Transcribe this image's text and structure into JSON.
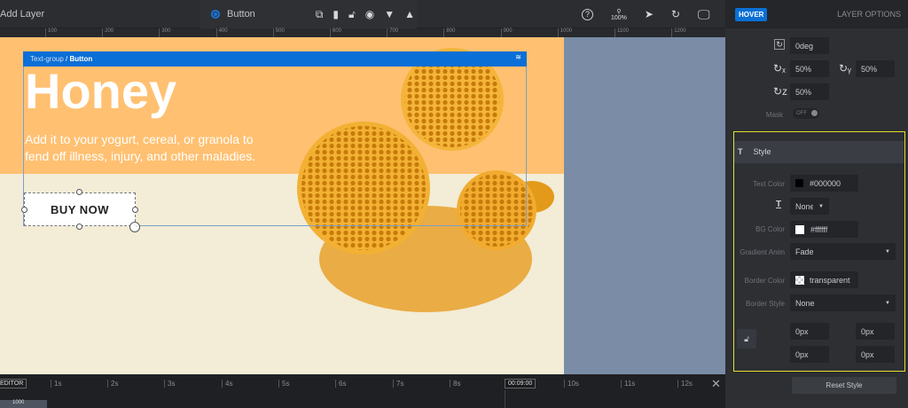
{
  "toolbar": {
    "add_layer": "Add Layer",
    "layer_name": "Button",
    "zoom": "100%"
  },
  "ruler": [
    "100",
    "200",
    "300",
    "400",
    "500",
    "600",
    "700",
    "800",
    "900",
    "1000",
    "1100",
    "1200"
  ],
  "canvas": {
    "breadcrumb_parent": "Text-group",
    "breadcrumb_sep": " / ",
    "breadcrumb_current": "Button",
    "heading": "Honey",
    "body_line1": "Add it to your yogurt, cereal, or granola to",
    "body_line2": "fend off illness, injury, and other maladies.",
    "button": "BUY NOW"
  },
  "panel": {
    "hover_tab": "HOVER",
    "layer_options_tab": "LAYER OPTIONS",
    "rotate": "0deg",
    "rot_x": "50%",
    "rot_y": "50%",
    "rot_z": "50%",
    "mask_label": "Mask",
    "mask_value": "OFF",
    "style_title": "Style",
    "text_color_label": "Text Color",
    "text_color": "#000000",
    "text_deco": "None",
    "bg_color_label": "BG Color",
    "bg_color": "#ffffff",
    "gradient_label": "Gradient Anim",
    "gradient": "Fade",
    "border_color_label": "Border Color",
    "border_color": "transparent",
    "border_style_label": "Border Style",
    "border_style": "None",
    "radius_tl": "0px",
    "radius_tr": "0px",
    "radius_bl": "0px",
    "radius_br": "0px",
    "reset": "Reset Style"
  },
  "timeline": {
    "editor": "EDITOR",
    "ticks": [
      "1s",
      "2s",
      "3s",
      "4s",
      "5s",
      "6s",
      "7s",
      "8s",
      "10s",
      "11s",
      "12s"
    ],
    "current": "00:09:00",
    "layer_time": "1000"
  },
  "colors": {
    "accent": "#0a6fd6",
    "highlight": "#e6e02a",
    "orange": "#ffc071",
    "cream": "#f3ecd6"
  }
}
